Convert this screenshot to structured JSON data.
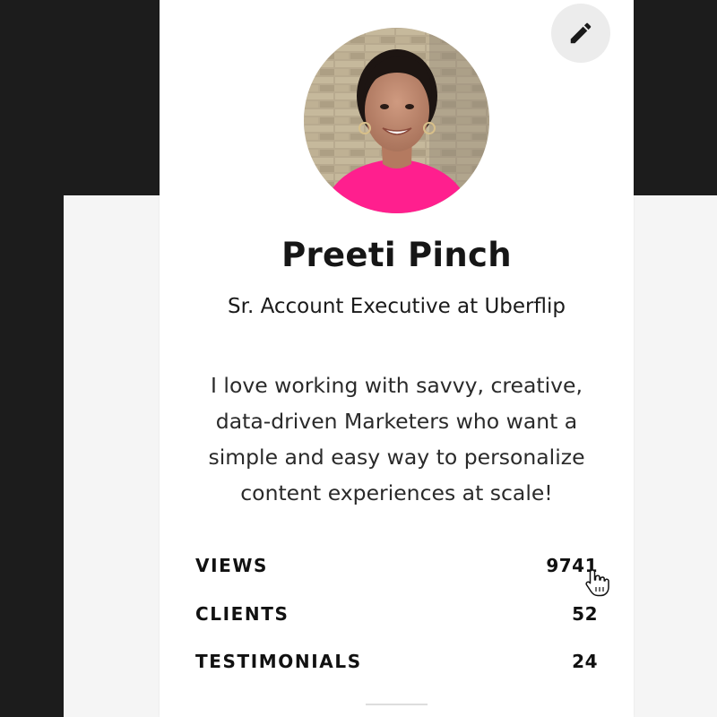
{
  "profile": {
    "name": "Preeti Pinch",
    "title": "Sr. Account Executive at Uberflip",
    "bio_lines": [
      "I love working with savvy, creative,",
      "data-driven Marketers who want a",
      "simple and easy way to personalize",
      "content experiences at scale!"
    ]
  },
  "stats": [
    {
      "label": "VIEWS",
      "value": "9741"
    },
    {
      "label": "CLIENTS",
      "value": "52"
    },
    {
      "label": "TESTIMONIALS",
      "value": "24"
    }
  ],
  "icons": {
    "edit": "pencil-icon",
    "cursor": "hand-pointer-icon"
  },
  "colors": {
    "shirt": "#ff1f8e",
    "card_background": "#ffffff",
    "page_background": "#f5f5f5",
    "dark_background": "#1c1c1c",
    "edit_button": "#ececec"
  }
}
